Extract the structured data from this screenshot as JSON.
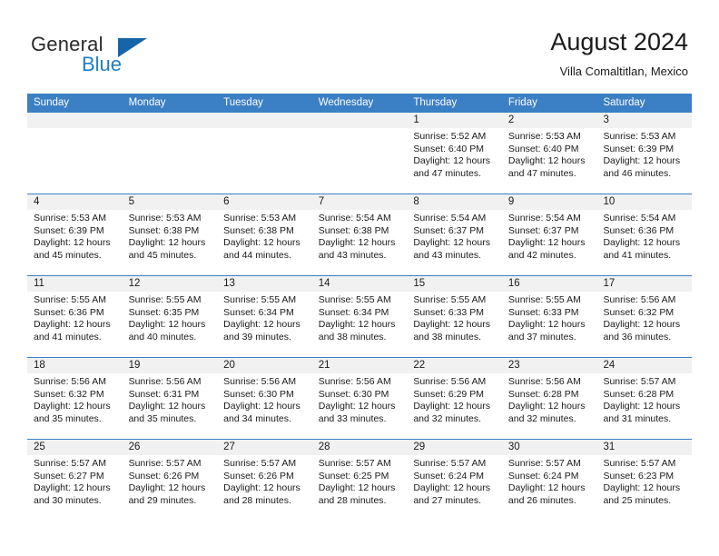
{
  "brand": {
    "line1": "General",
    "line2": "Blue",
    "logo_icon": "blue-triangle-icon"
  },
  "header": {
    "title": "August 2024",
    "subtitle": "Villa Comaltitlan, Mexico"
  },
  "colors": {
    "header_blue": "#3b7fc4",
    "brand_blue": "#1f7ec4",
    "day_number_band": "#f1f1f1",
    "text": "#1a1a1a"
  },
  "calendar": {
    "weekdays": [
      "Sunday",
      "Monday",
      "Tuesday",
      "Wednesday",
      "Thursday",
      "Friday",
      "Saturday"
    ],
    "weeks": [
      [
        {
          "day": "",
          "sunrise": "",
          "sunset": "",
          "daylight1": "",
          "daylight2": ""
        },
        {
          "day": "",
          "sunrise": "",
          "sunset": "",
          "daylight1": "",
          "daylight2": ""
        },
        {
          "day": "",
          "sunrise": "",
          "sunset": "",
          "daylight1": "",
          "daylight2": ""
        },
        {
          "day": "",
          "sunrise": "",
          "sunset": "",
          "daylight1": "",
          "daylight2": ""
        },
        {
          "day": "1",
          "sunrise": "Sunrise: 5:52 AM",
          "sunset": "Sunset: 6:40 PM",
          "daylight1": "Daylight: 12 hours",
          "daylight2": "and 47 minutes."
        },
        {
          "day": "2",
          "sunrise": "Sunrise: 5:53 AM",
          "sunset": "Sunset: 6:40 PM",
          "daylight1": "Daylight: 12 hours",
          "daylight2": "and 47 minutes."
        },
        {
          "day": "3",
          "sunrise": "Sunrise: 5:53 AM",
          "sunset": "Sunset: 6:39 PM",
          "daylight1": "Daylight: 12 hours",
          "daylight2": "and 46 minutes."
        }
      ],
      [
        {
          "day": "4",
          "sunrise": "Sunrise: 5:53 AM",
          "sunset": "Sunset: 6:39 PM",
          "daylight1": "Daylight: 12 hours",
          "daylight2": "and 45 minutes."
        },
        {
          "day": "5",
          "sunrise": "Sunrise: 5:53 AM",
          "sunset": "Sunset: 6:38 PM",
          "daylight1": "Daylight: 12 hours",
          "daylight2": "and 45 minutes."
        },
        {
          "day": "6",
          "sunrise": "Sunrise: 5:53 AM",
          "sunset": "Sunset: 6:38 PM",
          "daylight1": "Daylight: 12 hours",
          "daylight2": "and 44 minutes."
        },
        {
          "day": "7",
          "sunrise": "Sunrise: 5:54 AM",
          "sunset": "Sunset: 6:38 PM",
          "daylight1": "Daylight: 12 hours",
          "daylight2": "and 43 minutes."
        },
        {
          "day": "8",
          "sunrise": "Sunrise: 5:54 AM",
          "sunset": "Sunset: 6:37 PM",
          "daylight1": "Daylight: 12 hours",
          "daylight2": "and 43 minutes."
        },
        {
          "day": "9",
          "sunrise": "Sunrise: 5:54 AM",
          "sunset": "Sunset: 6:37 PM",
          "daylight1": "Daylight: 12 hours",
          "daylight2": "and 42 minutes."
        },
        {
          "day": "10",
          "sunrise": "Sunrise: 5:54 AM",
          "sunset": "Sunset: 6:36 PM",
          "daylight1": "Daylight: 12 hours",
          "daylight2": "and 41 minutes."
        }
      ],
      [
        {
          "day": "11",
          "sunrise": "Sunrise: 5:55 AM",
          "sunset": "Sunset: 6:36 PM",
          "daylight1": "Daylight: 12 hours",
          "daylight2": "and 41 minutes."
        },
        {
          "day": "12",
          "sunrise": "Sunrise: 5:55 AM",
          "sunset": "Sunset: 6:35 PM",
          "daylight1": "Daylight: 12 hours",
          "daylight2": "and 40 minutes."
        },
        {
          "day": "13",
          "sunrise": "Sunrise: 5:55 AM",
          "sunset": "Sunset: 6:34 PM",
          "daylight1": "Daylight: 12 hours",
          "daylight2": "and 39 minutes."
        },
        {
          "day": "14",
          "sunrise": "Sunrise: 5:55 AM",
          "sunset": "Sunset: 6:34 PM",
          "daylight1": "Daylight: 12 hours",
          "daylight2": "and 38 minutes."
        },
        {
          "day": "15",
          "sunrise": "Sunrise: 5:55 AM",
          "sunset": "Sunset: 6:33 PM",
          "daylight1": "Daylight: 12 hours",
          "daylight2": "and 38 minutes."
        },
        {
          "day": "16",
          "sunrise": "Sunrise: 5:55 AM",
          "sunset": "Sunset: 6:33 PM",
          "daylight1": "Daylight: 12 hours",
          "daylight2": "and 37 minutes."
        },
        {
          "day": "17",
          "sunrise": "Sunrise: 5:56 AM",
          "sunset": "Sunset: 6:32 PM",
          "daylight1": "Daylight: 12 hours",
          "daylight2": "and 36 minutes."
        }
      ],
      [
        {
          "day": "18",
          "sunrise": "Sunrise: 5:56 AM",
          "sunset": "Sunset: 6:32 PM",
          "daylight1": "Daylight: 12 hours",
          "daylight2": "and 35 minutes."
        },
        {
          "day": "19",
          "sunrise": "Sunrise: 5:56 AM",
          "sunset": "Sunset: 6:31 PM",
          "daylight1": "Daylight: 12 hours",
          "daylight2": "and 35 minutes."
        },
        {
          "day": "20",
          "sunrise": "Sunrise: 5:56 AM",
          "sunset": "Sunset: 6:30 PM",
          "daylight1": "Daylight: 12 hours",
          "daylight2": "and 34 minutes."
        },
        {
          "day": "21",
          "sunrise": "Sunrise: 5:56 AM",
          "sunset": "Sunset: 6:30 PM",
          "daylight1": "Daylight: 12 hours",
          "daylight2": "and 33 minutes."
        },
        {
          "day": "22",
          "sunrise": "Sunrise: 5:56 AM",
          "sunset": "Sunset: 6:29 PM",
          "daylight1": "Daylight: 12 hours",
          "daylight2": "and 32 minutes."
        },
        {
          "day": "23",
          "sunrise": "Sunrise: 5:56 AM",
          "sunset": "Sunset: 6:28 PM",
          "daylight1": "Daylight: 12 hours",
          "daylight2": "and 32 minutes."
        },
        {
          "day": "24",
          "sunrise": "Sunrise: 5:57 AM",
          "sunset": "Sunset: 6:28 PM",
          "daylight1": "Daylight: 12 hours",
          "daylight2": "and 31 minutes."
        }
      ],
      [
        {
          "day": "25",
          "sunrise": "Sunrise: 5:57 AM",
          "sunset": "Sunset: 6:27 PM",
          "daylight1": "Daylight: 12 hours",
          "daylight2": "and 30 minutes."
        },
        {
          "day": "26",
          "sunrise": "Sunrise: 5:57 AM",
          "sunset": "Sunset: 6:26 PM",
          "daylight1": "Daylight: 12 hours",
          "daylight2": "and 29 minutes."
        },
        {
          "day": "27",
          "sunrise": "Sunrise: 5:57 AM",
          "sunset": "Sunset: 6:26 PM",
          "daylight1": "Daylight: 12 hours",
          "daylight2": "and 28 minutes."
        },
        {
          "day": "28",
          "sunrise": "Sunrise: 5:57 AM",
          "sunset": "Sunset: 6:25 PM",
          "daylight1": "Daylight: 12 hours",
          "daylight2": "and 28 minutes."
        },
        {
          "day": "29",
          "sunrise": "Sunrise: 5:57 AM",
          "sunset": "Sunset: 6:24 PM",
          "daylight1": "Daylight: 12 hours",
          "daylight2": "and 27 minutes."
        },
        {
          "day": "30",
          "sunrise": "Sunrise: 5:57 AM",
          "sunset": "Sunset: 6:24 PM",
          "daylight1": "Daylight: 12 hours",
          "daylight2": "and 26 minutes."
        },
        {
          "day": "31",
          "sunrise": "Sunrise: 5:57 AM",
          "sunset": "Sunset: 6:23 PM",
          "daylight1": "Daylight: 12 hours",
          "daylight2": "and 25 minutes."
        }
      ]
    ]
  }
}
